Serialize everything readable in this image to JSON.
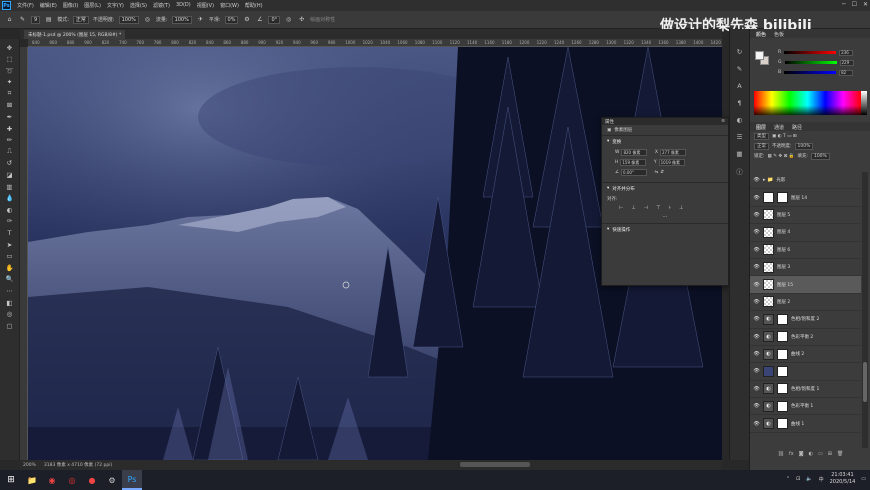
{
  "app": {
    "logo": "Ps"
  },
  "menu": [
    "文件(F)",
    "编辑(E)",
    "图像(I)",
    "图层(L)",
    "文字(Y)",
    "选择(S)",
    "滤镜(T)",
    "3D(D)",
    "视图(V)",
    "窗口(W)",
    "帮助(H)"
  ],
  "options": {
    "size_value": "9",
    "mode_label": "模式:",
    "mode_value": "正常",
    "opacity_label": "不透明度:",
    "opacity_value": "100%",
    "flow_label": "流量:",
    "flow_value": "100%",
    "smoothing_label": "平滑:",
    "smoothing_value": "0%",
    "angle_value": "0°",
    "symmetry_label": "绘画对称性"
  },
  "watermark": "做设计的梨先森 bilibili",
  "document": {
    "tab_title": "未标题-1.psd @ 200% (图层 15, RGB/8#) *",
    "ruler_ticks": [
      "840",
      "860",
      "880",
      "900",
      "820",
      "740",
      "760",
      "780",
      "800",
      "820",
      "840",
      "860",
      "880",
      "900",
      "920",
      "940",
      "960",
      "980",
      "1000",
      "1020",
      "1040",
      "1060",
      "1080",
      "1100",
      "1120",
      "1140",
      "1160",
      "1180",
      "1200",
      "1220",
      "1240",
      "1260",
      "1280",
      "1300",
      "1320",
      "1340",
      "1360",
      "1380",
      "1400",
      "1420"
    ]
  },
  "status": {
    "zoom": "200%",
    "doc_info": "3183 像素 x 4710 像素 (72 ppi)"
  },
  "color_panel": {
    "tabs": [
      "颜色",
      "色板"
    ],
    "r": "236",
    "g": "229",
    "b": "82",
    "colors": {
      "fg": "#f4f4f4",
      "bg": "#d8d0c8"
    }
  },
  "layers_panel": {
    "tabs": [
      "图层",
      "通道",
      "路径"
    ],
    "filter_label": "类型",
    "blend_mode": "正常",
    "opacity_label": "不透明度:",
    "opacity_value": "100%",
    "lock_label": "锁定:",
    "fill_label": "填充:",
    "fill_value": "100%",
    "layers": [
      {
        "name": "光影",
        "type": "group",
        "selected": false
      },
      {
        "name": "图层 14",
        "type": "mask",
        "selected": false
      },
      {
        "name": "图层 5",
        "type": "checker",
        "selected": false
      },
      {
        "name": "图层 4",
        "type": "checker",
        "selected": false
      },
      {
        "name": "图层 6",
        "type": "checker",
        "selected": false
      },
      {
        "name": "图层 3",
        "type": "checker",
        "selected": false
      },
      {
        "name": "图层 15",
        "type": "checker",
        "selected": true
      },
      {
        "name": "图层 2",
        "type": "checker",
        "selected": false
      },
      {
        "name": "色相/饱和度 2",
        "type": "adj",
        "selected": false
      },
      {
        "name": "色彩平衡 2",
        "type": "adj",
        "selected": false
      },
      {
        "name": "曲线 2",
        "type": "adj",
        "selected": false
      },
      {
        "name": "",
        "type": "photo",
        "selected": false
      },
      {
        "name": "色相/饱和度 1",
        "type": "adj",
        "selected": false
      },
      {
        "name": "色彩平衡 1",
        "type": "adj",
        "selected": false
      },
      {
        "name": "曲线 1",
        "type": "adj",
        "selected": false
      }
    ]
  },
  "properties": {
    "title": "属性",
    "subtitle": "像素图层",
    "transform_label": "变换",
    "w_label": "W",
    "w_value": "820 像素",
    "x_label": "X",
    "x_value": "277 像素",
    "h_label": "H",
    "h_value": "159 像素",
    "y_label": "Y",
    "y_value": "1019 像素",
    "angle_value": "0.00°",
    "align_label": "对齐并分布",
    "align_sub": "对齐:",
    "quick_label": "快速操作"
  },
  "taskbar": {
    "time": "21:03:41",
    "date": "2020/5/14",
    "ime": "中"
  }
}
